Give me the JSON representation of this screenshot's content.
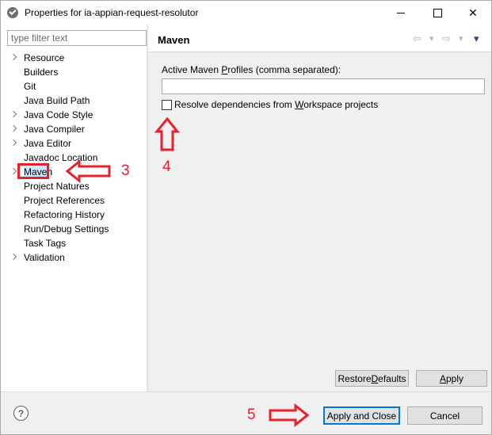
{
  "window": {
    "title": "Properties for ia-appian-request-resolutor",
    "minimize_icon": "minimize-icon",
    "maximize_icon": "maximize-icon",
    "close_label": "✕"
  },
  "sidebar": {
    "filter_placeholder": "type filter text",
    "items": [
      {
        "label": "Resource",
        "expandable": true
      },
      {
        "label": "Builders",
        "expandable": false
      },
      {
        "label": "Git",
        "expandable": false
      },
      {
        "label": "Java Build Path",
        "expandable": false
      },
      {
        "label": "Java Code Style",
        "expandable": true
      },
      {
        "label": "Java Compiler",
        "expandable": true
      },
      {
        "label": "Java Editor",
        "expandable": true
      },
      {
        "label": "Javadoc Location",
        "expandable": false
      },
      {
        "label": "Maven",
        "expandable": true,
        "selected": true
      },
      {
        "label": "Project Natures",
        "expandable": false
      },
      {
        "label": "Project References",
        "expandable": false
      },
      {
        "label": "Refactoring History",
        "expandable": false
      },
      {
        "label": "Run/Debug Settings",
        "expandable": false
      },
      {
        "label": "Task Tags",
        "expandable": false
      },
      {
        "label": "Validation",
        "expandable": true
      }
    ]
  },
  "page": {
    "title": "Maven",
    "nav": {
      "back": "⇦",
      "back_menu": "▾",
      "forward": "⇨",
      "forward_menu": "▾",
      "view_menu": "▾"
    },
    "profiles_label_pre": "Active Maven ",
    "profiles_label_mnemonic": "P",
    "profiles_label_post": "rofiles (comma separated):",
    "profiles_value": "",
    "resolve_checked": false,
    "resolve_label_pre": "Resolve dependencies from ",
    "resolve_label_mnemonic": "W",
    "resolve_label_post": "orkspace projects",
    "restore_pre": "Restore ",
    "restore_mnemonic": "D",
    "restore_post": "efaults",
    "apply_mnemonic": "A",
    "apply_post": "pply"
  },
  "footer": {
    "help_glyph": "?",
    "apply_close_label": "Apply and Close",
    "cancel_label": "Cancel"
  },
  "annotations": {
    "step3": "3",
    "step4": "4",
    "step5": "5",
    "color": "#e8202a"
  }
}
